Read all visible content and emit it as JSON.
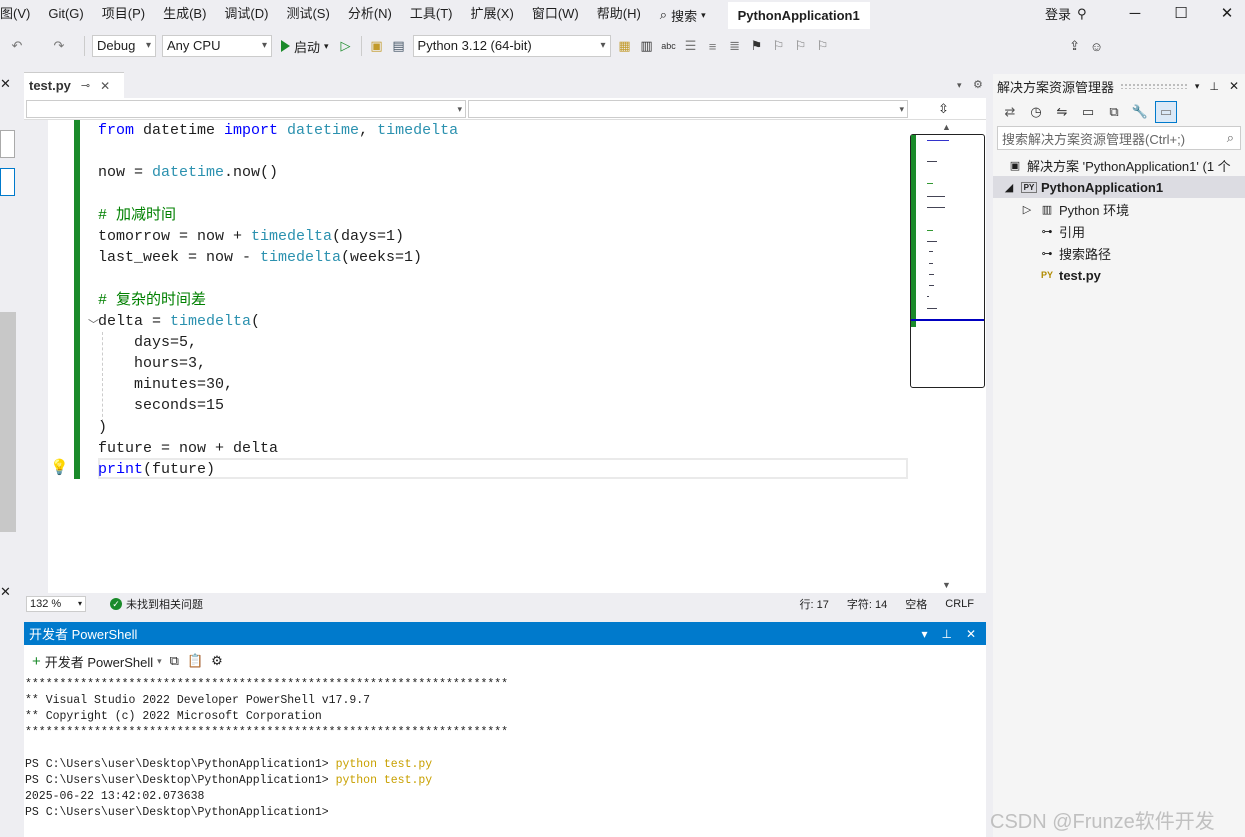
{
  "menubar": {
    "items": [
      "图(V)",
      "Git(G)",
      "项目(P)",
      "生成(B)",
      "调试(D)",
      "测试(S)",
      "分析(N)",
      "工具(T)",
      "扩展(X)",
      "窗口(W)",
      "帮助(H)"
    ],
    "search_label": "搜索",
    "window_title": "PythonApplication1",
    "login_label": "登录"
  },
  "toolbar": {
    "config": "Debug",
    "platform": "Any CPU",
    "start_label": "启动",
    "python_env": "Python 3.12 (64-bit)"
  },
  "editor": {
    "tab_name": "test.py",
    "zoom": "132 %",
    "status_message": "未找到相关问题",
    "line_label": "行: 17",
    "char_label": "字符: 14",
    "whitespace_label": "空格",
    "eol_label": "CRLF"
  },
  "code": {
    "l1_from": "from",
    "l1_mod": " datetime ",
    "l1_import": "import",
    "l1_c1": " datetime",
    "l1_comma": ", ",
    "l1_c2": "timedelta",
    "l3_a": "now = ",
    "l3_fn": "datetime",
    "l3_b": ".now()",
    "l5_cm": "# 加减时间",
    "l6_a": "tomorrow = now + ",
    "l6_fn": "timedelta",
    "l6_b": "(days=1)",
    "l7_a": "last_week = now - ",
    "l7_fn": "timedelta",
    "l7_b": "(weeks=1)",
    "l9_cm": "# 复杂的时间差",
    "l10_a": "delta = ",
    "l10_fn": "timedelta",
    "l10_b": "(",
    "l11": "    days=5,",
    "l12": "    hours=3,",
    "l13": "    minutes=30,",
    "l14": "    seconds=15",
    "l15": ")",
    "l16": "future = now + delta",
    "l17_fn": "print",
    "l17_b": "(future)"
  },
  "terminal": {
    "title": "开发者 PowerShell",
    "new_label": "开发者 PowerShell",
    "lines": [
      "**********************************************************************",
      "** Visual Studio 2022 Developer PowerShell v17.9.7",
      "** Copyright (c) 2022 Microsoft Corporation",
      "**********************************************************************"
    ],
    "prompt": "PS C:\\Users\\user\\Desktop\\PythonApplication1> ",
    "cmd": "python test.py",
    "output": "2025-06-22 13:42:02.073638"
  },
  "solution_explorer": {
    "title": "解决方案资源管理器",
    "search_placeholder": "搜索解决方案资源管理器(Ctrl+;)",
    "solution": "解决方案 'PythonApplication1' (1 个",
    "project": "PythonApplication1",
    "env": "Python 环境",
    "refs": "引用",
    "search_paths": "搜索路径",
    "file": "test.py"
  },
  "watermark": "CSDN @Frunze软件开发"
}
